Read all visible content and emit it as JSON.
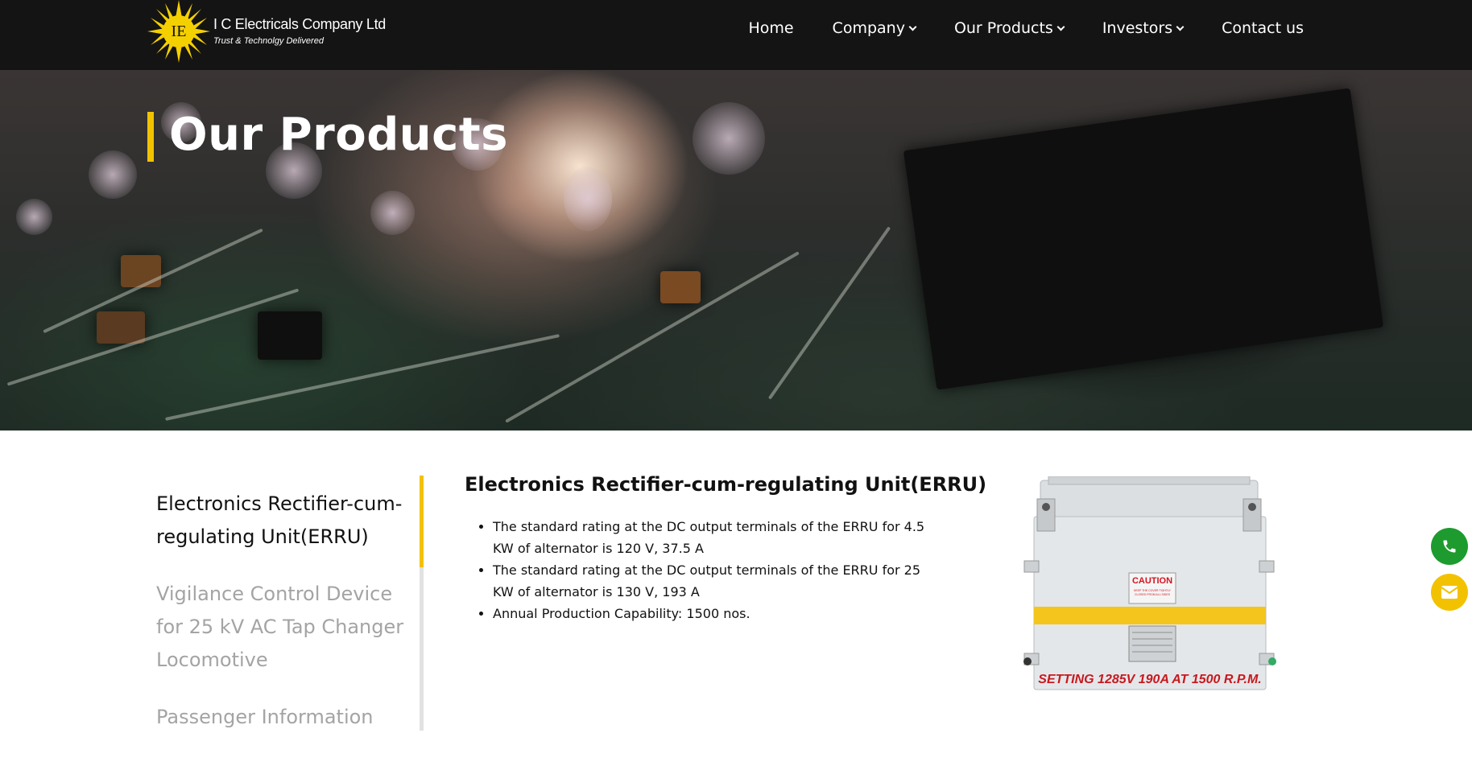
{
  "header": {
    "logo_initials": "IE",
    "company_name": "I C Electricals Company Ltd",
    "tagline": "Trust & Technolgy Delivered",
    "nav": [
      {
        "label": "Home",
        "has_dropdown": false
      },
      {
        "label": "Company",
        "has_dropdown": true
      },
      {
        "label": "Our Products",
        "has_dropdown": true
      },
      {
        "label": "Investors",
        "has_dropdown": true
      },
      {
        "label": "Contact us",
        "has_dropdown": false
      }
    ]
  },
  "hero": {
    "title": "Our Products"
  },
  "sidebar": {
    "items": [
      {
        "label": "Electronics Rectifier-cum-regulating Unit(ERRU)",
        "active": true
      },
      {
        "label": "Vigilance Control Device for 25 kV AC Tap Changer Locomotive",
        "active": false
      },
      {
        "label": "Passenger Information",
        "active": false
      }
    ]
  },
  "product": {
    "title": "Electronics Rectifier-cum-regulating Unit(ERRU)",
    "bullets": [
      "The standard rating at the DC output terminals of the ERRU for 4.5 KW of alternator is 120 V, 37.5 A",
      "The standard rating at the DC output terminals of the ERRU for 25 KW of alternator is 130 V, 193 A",
      "Annual Production Capability: 1500 nos."
    ],
    "image": {
      "caution_label": "CAUTION",
      "caution_subtext": "KEEP THE COVER TIGHTLY CLOSED FROM ALL SIDES",
      "setting_text": "SETTING 1285V 190A AT 1500 R.P.M."
    }
  },
  "floating": {
    "phone_icon": "phone-icon",
    "mail_icon": "envelope-icon"
  },
  "colors": {
    "accent": "#f2c200",
    "header_bg": "#141414",
    "phone_button": "#1e9b2f",
    "inactive_text": "#a4a4a4"
  }
}
